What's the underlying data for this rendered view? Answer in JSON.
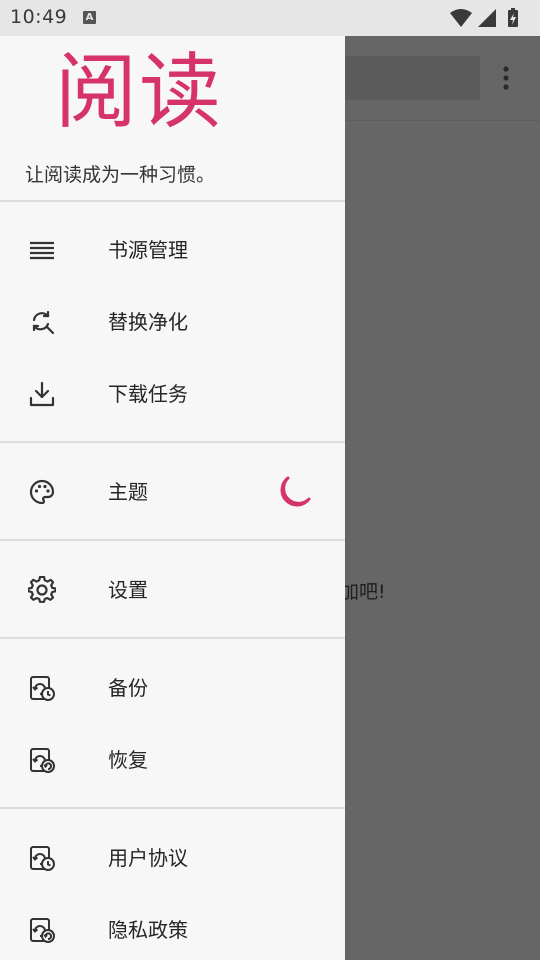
{
  "status_bar": {
    "time": "10:49",
    "notification_icon": "a-icon",
    "icons": [
      "wifi-icon",
      "signal-icon",
      "battery-charging-icon"
    ]
  },
  "background": {
    "more_icon": "more-vertical-icon",
    "empty_text": "加吧!"
  },
  "drawer": {
    "logo": "阅读",
    "slogan": "让阅读成为一种习惯。",
    "accent_color": "#d6336c",
    "items": [
      {
        "label": "书源管理",
        "icon": "list-icon"
      },
      {
        "label": "替换净化",
        "icon": "find-replace-icon"
      },
      {
        "label": "下载任务",
        "icon": "download-icon"
      },
      {
        "label": "主题",
        "icon": "palette-icon",
        "toggle_icon": "night-mode-icon"
      },
      {
        "label": "设置",
        "icon": "gear-icon"
      },
      {
        "label": "备份",
        "icon": "backup-icon"
      },
      {
        "label": "恢复",
        "icon": "restore-icon"
      },
      {
        "label": "用户协议",
        "icon": "agreement-icon"
      },
      {
        "label": "隐私政策",
        "icon": "privacy-icon"
      }
    ]
  }
}
